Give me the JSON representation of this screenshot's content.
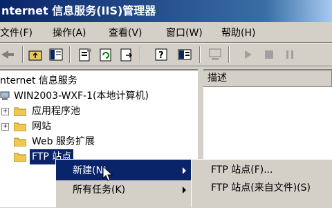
{
  "window": {
    "title": "nternet 信息服务(IIS)管理器"
  },
  "menu": [
    "文件(F)",
    "操作(A)",
    "查看(V)",
    "窗口(W)",
    "帮助(H)"
  ],
  "toolbar": {
    "icons": [
      "back-arrow-icon",
      "up-folder-icon",
      "show-hide-tree-icon",
      "properties-icon",
      "refresh-icon",
      "export-list-icon",
      "help-icon",
      "view-icon",
      "computer-icon",
      "play-icon",
      "stop-icon",
      "pause-icon"
    ]
  },
  "tree": {
    "root": "nternet 信息服务",
    "server": "WIN2003-WXF-1(本地计算机)",
    "items": [
      "应用程序池",
      "网站",
      "Web 服务扩展",
      "FTP 站点"
    ]
  },
  "list": {
    "column": "描述"
  },
  "context_menu": {
    "items": [
      {
        "label": "新建(N)",
        "highlighted": true
      },
      {
        "label": "所有任务(K)",
        "highlighted": false
      }
    ],
    "submenu": [
      "FTP 站点(F)...",
      "FTP 站点(来自文件)(S)"
    ]
  },
  "colors": {
    "title_start": "#0a246a",
    "title_end": "#a6caf0",
    "face": "#d4d0c8",
    "highlight": "#0a246a"
  }
}
